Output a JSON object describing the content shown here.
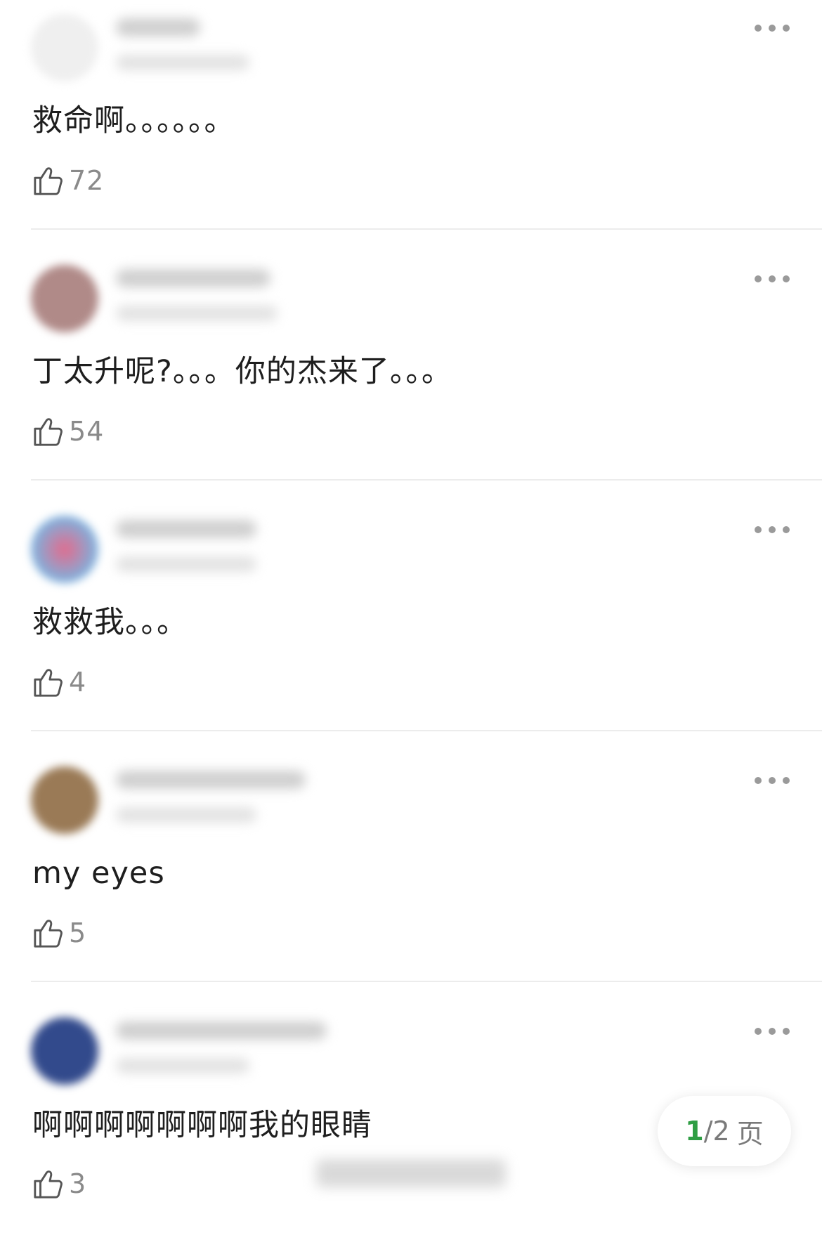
{
  "comments": [
    {
      "text": "救命啊。。。。。。",
      "likes": "72",
      "avatar_color": "#eeeeee"
    },
    {
      "text": "丁太升呢?。。。你的杰来了。。。",
      "likes": "54",
      "avatar_color": "#b08a88"
    },
    {
      "text": "救救我。。。",
      "likes": "4",
      "avatar_color": "#e36b8c"
    },
    {
      "text": "my eyes",
      "likes": "5",
      "avatar_color": "#9a7a56"
    },
    {
      "text": "啊啊啊啊啊啊啊我的眼睛",
      "likes": "3",
      "avatar_color": "#324a8c"
    }
  ],
  "pager": {
    "current": "1",
    "separator": "/",
    "total": "2",
    "unit": "页",
    "accent_color": "#2f9e44"
  },
  "icons": {
    "like": "thumbs-up-icon",
    "more": "more-dots-icon"
  }
}
